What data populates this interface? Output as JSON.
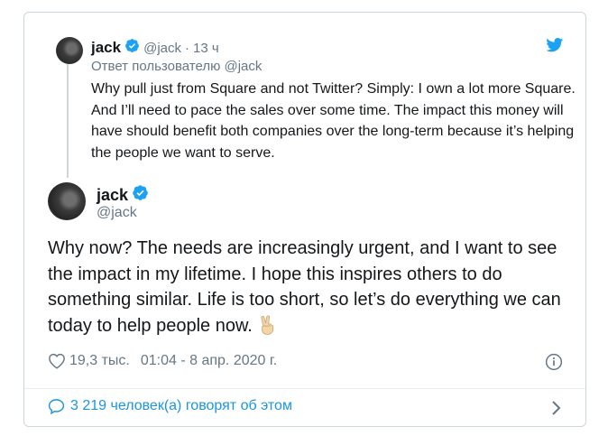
{
  "parent_tweet": {
    "name": "jack",
    "handle": "@jack",
    "separator": "·",
    "time": "13 ч",
    "reply_to": "Ответ пользователю @jack",
    "text": "Why pull just from Square and not Twitter? Simply: I own a lot more Square. And I’ll  need to pace the sales over some time. The impact this money will have should benefit both companies over the long-term because it’s helping the people we want to serve."
  },
  "main_tweet": {
    "name": "jack",
    "handle": "@jack",
    "text": "Why now? The needs are increasingly urgent, and I want to see the impact in my lifetime. I hope this inspires others to do something similar. Life is too short, so let’s do everything we can today to help people now.",
    "emoji": "peace-hand",
    "likes": "19,3 тыс.",
    "timestamp": "01:04 - 8 апр. 2020 г."
  },
  "footer": {
    "conversation_label": "3 219 человек(а) говорят об этом"
  },
  "icons": {
    "brand": "twitter-bird-icon",
    "verified": "verified-badge-icon",
    "like": "heart-icon",
    "info": "info-icon",
    "reply": "speech-bubble-icon",
    "more": "chevron-right-icon"
  },
  "colors": {
    "brand_blue": "#1da1f2",
    "link_blue": "#1b95e0",
    "secondary_text": "#657786",
    "border": "#ccd6dd"
  }
}
